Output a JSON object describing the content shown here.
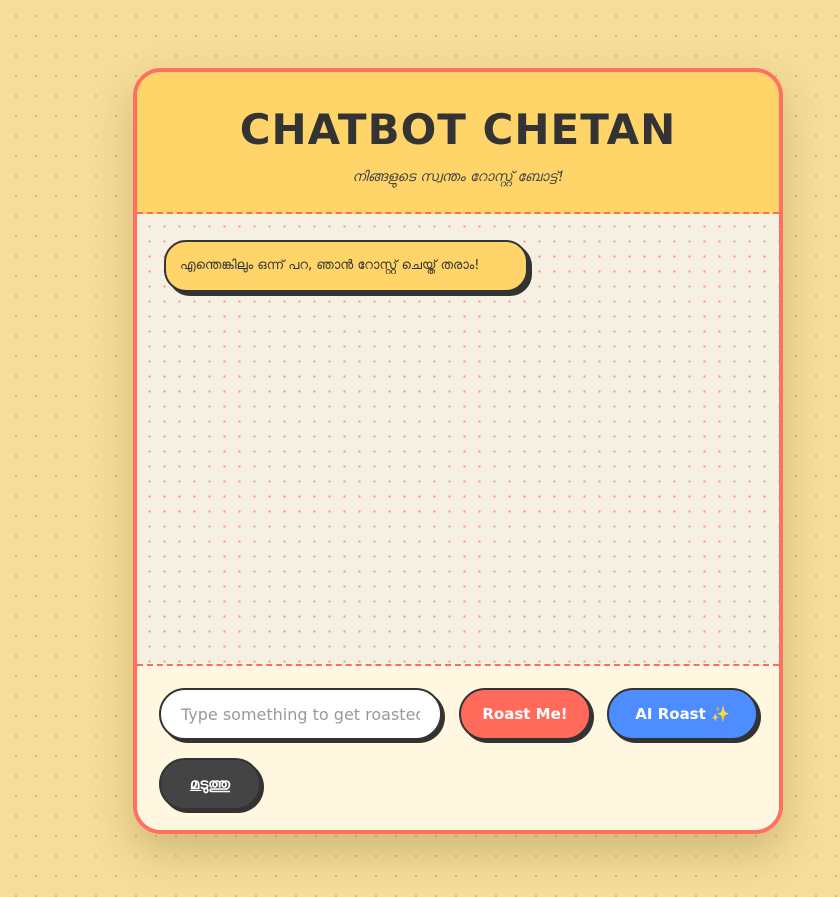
{
  "header": {
    "title": "CHATBOT CHETAN",
    "subtitle": "നിങ്ങളുടെ സ്വന്തം റോസ്റ്റ് ബോട്ട്!"
  },
  "chat": {
    "messages": [
      {
        "sender": "bot",
        "text": "എന്തെങ്കിലും ഒന്ന് പറ, ഞാൻ റോസ്റ്റ് ചെയ്ത് തരാം!"
      }
    ]
  },
  "controls": {
    "input": {
      "value": "",
      "placeholder": "Type something to get roasted..."
    },
    "roast_label": "Roast Me!",
    "ai_roast_label": "AI Roast ✨",
    "clear_label": "മടുത്തു"
  },
  "colors": {
    "page_bg": "#f5dd9a",
    "card_border": "#ff7060",
    "header_bg": "#ffd56a",
    "bubble_bg": "#ffd56a",
    "roast_button": "#ff6a5a",
    "ai_button": "#4d8dff",
    "clear_button": "#444444",
    "ink": "#333333"
  }
}
